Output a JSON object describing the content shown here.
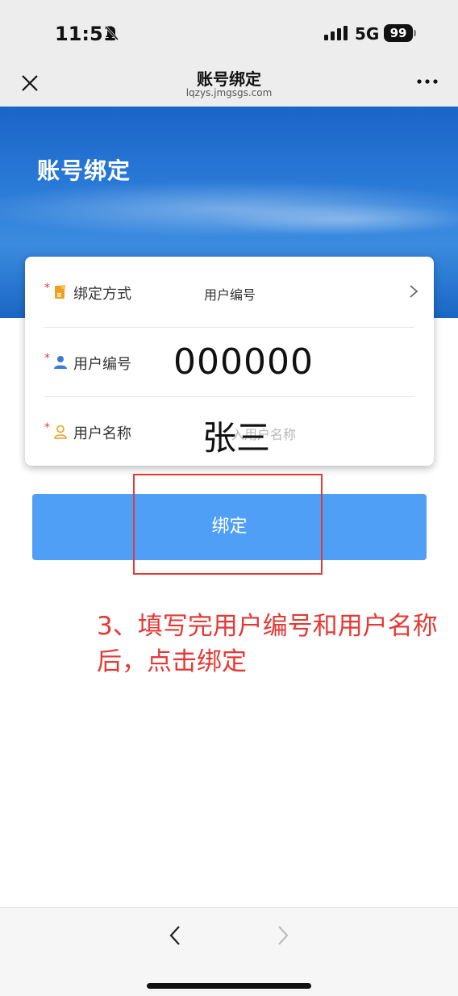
{
  "status_bar": {
    "time": "11:51",
    "network": "5G",
    "battery": "99"
  },
  "nav": {
    "title": "账号绑定",
    "subtitle": "lqzys.jmgsgs.com"
  },
  "banner": {
    "title": "账号绑定"
  },
  "form": {
    "required_mark": "*",
    "rows": [
      {
        "label": "绑定方式",
        "value": "用户编号",
        "icon": "document-icon"
      },
      {
        "label": "用户编号",
        "value": "000000",
        "icon": "user-icon"
      },
      {
        "label": "用户名称",
        "value": "张三",
        "placeholder": "入用户名称",
        "icon": "user-outline-icon"
      }
    ]
  },
  "bind_button": {
    "label": "绑定"
  },
  "annotation": {
    "text": "3、填写完用户编号和用户名称后，点击绑定",
    "color": "#e53935"
  },
  "colors": {
    "primary_button": "#4f9ff6",
    "banner": "#2a7bd8",
    "required": "#e23b3b",
    "icon_orange": "#f0a020",
    "icon_blue": "#3a7bd5"
  }
}
